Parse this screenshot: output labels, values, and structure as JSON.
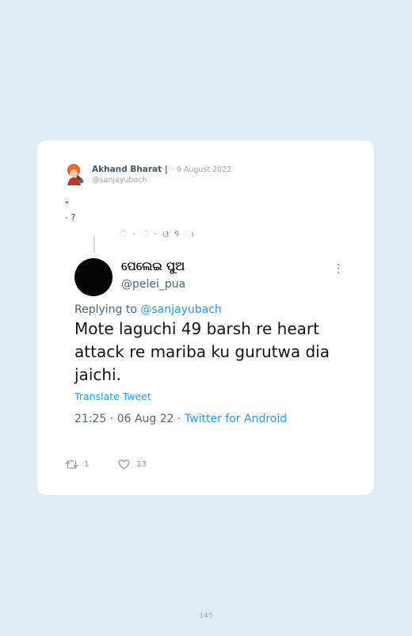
{
  "tweet": {
    "author_name": "Akhand Bharat |",
    "date": "· 9 August 2022",
    "handle": "@sanjayubach",
    "body_lines": "\"\n- ?"
  },
  "embedded_tweet": {
    "display_name": "ପେଲେଇ ପୁଅ",
    "handle": "@pelei_pua",
    "replying_prefix": "Replying to",
    "replying_to": "@sanjayubach",
    "text": "Mote laguchi 49 barsh re heart attack re mariba ku gurutwa dia jaichi.",
    "translate_label": "Translate Tweet",
    "timestamp": "21:25 · 06 Aug 22 ·",
    "source": "Twitter for Android"
  },
  "actions": {
    "retweet_count": "1",
    "like_count": "13"
  },
  "page_number": "145",
  "colors": {
    "background": "#e1edf6",
    "card": "#ffffff",
    "link_blue": "#1d9bf0"
  }
}
